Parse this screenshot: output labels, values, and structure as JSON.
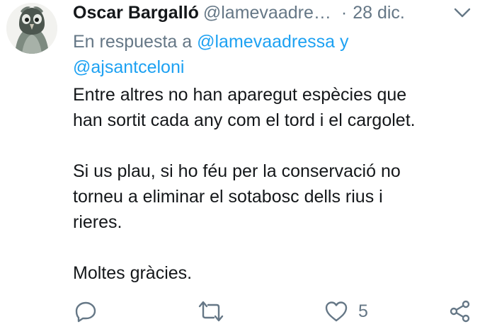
{
  "tweet": {
    "author": {
      "name": "Oscar Bargalló",
      "handle": "@lamevaadre…",
      "separator": "·",
      "date": "28 dic."
    },
    "reply_to": {
      "prefix": "En respuesta a",
      "mention_1": "@lamevaadressa",
      "conjunction": "y",
      "mention_2": "@ajsantceloni"
    },
    "body": {
      "line_1": "Entre altres no han aparegut espècies que",
      "line_2": "han sortit cada any com el tord i el cargolet.",
      "line_3": "Si us plau, si ho féu per la conservació no",
      "line_4": "torneu a eliminar el sotabosc dells rius i",
      "line_5": "rieres.",
      "line_6": "Moltes gràcies."
    },
    "actions": {
      "reply_icon": "reply-icon",
      "retweet_icon": "retweet-icon",
      "like_icon": "heart-icon",
      "like_count": "5",
      "share_icon": "share-icon"
    }
  },
  "colors": {
    "text": "#14171a",
    "secondary": "#657786",
    "mention": "#1da1f2"
  }
}
